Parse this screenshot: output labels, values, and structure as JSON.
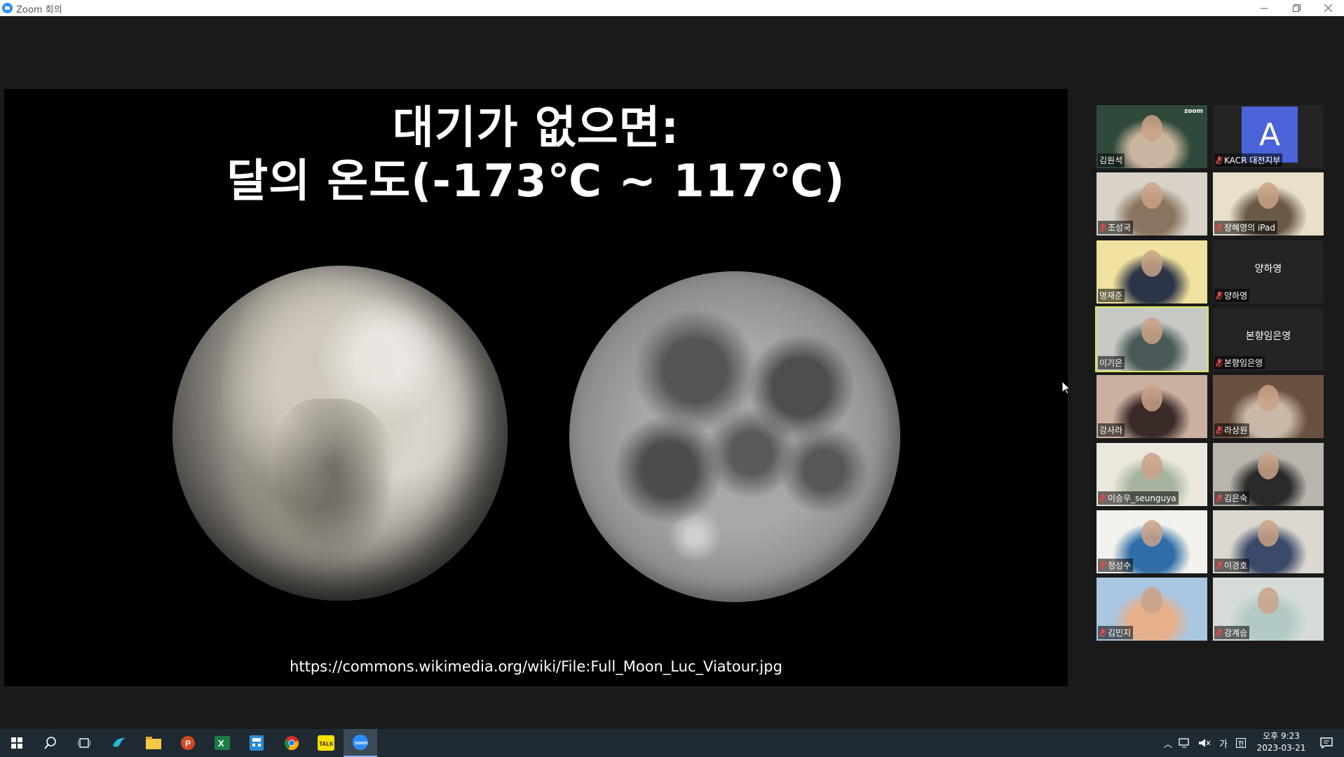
{
  "window": {
    "title": "Zoom 회의"
  },
  "slide": {
    "title_line1": "대기가 없으면:",
    "title_line2": "달의 온도(-173℃ ~ 117℃)",
    "url": "https://commons.wikimedia.org/wiki/File:Full_Moon_Luc_Viatour.jpg"
  },
  "participants": [
    {
      "name": "김원석",
      "muted": false,
      "video": true,
      "colors": [
        "#2f4a3a",
        "#c9b5a0"
      ],
      "extra_label": "zoom"
    },
    {
      "name": "KACR 대전지부",
      "muted": true,
      "video": false,
      "avatar_letter": "A"
    },
    {
      "name": "조성국",
      "muted": true,
      "video": true,
      "colors": [
        "#d8d2c8",
        "#8a7660"
      ]
    },
    {
      "name": "장혜영의 iPad",
      "muted": true,
      "video": true,
      "colors": [
        "#e8e0c8",
        "#6a5a48"
      ]
    },
    {
      "name": "명재준",
      "muted": false,
      "video": true,
      "colors": [
        "#f2e2a0",
        "#2c3548"
      ]
    },
    {
      "name": "양하영",
      "muted": true,
      "video": false,
      "center_name": "양하영"
    },
    {
      "name": "이기은",
      "muted": false,
      "video": true,
      "active": true,
      "colors": [
        "#c7c9c4",
        "#4a5a58"
      ]
    },
    {
      "name": "본향임은영",
      "muted": true,
      "video": false,
      "center_name": "본향임은영"
    },
    {
      "name": "강사라",
      "muted": false,
      "video": true,
      "colors": [
        "#cbb0a0",
        "#3a2a28"
      ]
    },
    {
      "name": "라상원",
      "muted": true,
      "video": true,
      "colors": [
        "#6a5040",
        "#c8b8a8"
      ]
    },
    {
      "name": "이승우_seunguya",
      "muted": true,
      "video": true,
      "colors": [
        "#ece7dc",
        "#a7b5a0"
      ]
    },
    {
      "name": "김은숙",
      "muted": true,
      "video": true,
      "colors": [
        "#b9b4ac",
        "#2a2a2a"
      ]
    },
    {
      "name": "정성수",
      "muted": true,
      "video": true,
      "colors": [
        "#f3f1ec",
        "#2f6da8"
      ]
    },
    {
      "name": "이경호",
      "muted": true,
      "video": true,
      "colors": [
        "#dcd8d0",
        "#3a4a68"
      ]
    },
    {
      "name": "김민지",
      "muted": true,
      "video": true,
      "colors": [
        "#a9c6e0",
        "#e6b08a"
      ]
    },
    {
      "name": "강계승",
      "muted": true,
      "video": true,
      "colors": [
        "#d5dcd8",
        "#b3c9c6"
      ]
    }
  ],
  "taskbar": {
    "apps": [
      "start-icon",
      "search-icon",
      "task-view-icon",
      "bird-app-icon",
      "file-explorer-icon",
      "powerpoint-icon",
      "excel-icon",
      "calculator-app-icon",
      "chrome-icon",
      "kakaotalk-icon",
      "zoom-icon"
    ],
    "kakaotalk_label": "TALK",
    "zoom_label": "zoom",
    "ime": "가",
    "clock_time": "오후 9:23",
    "clock_date": "2023-03-21"
  }
}
